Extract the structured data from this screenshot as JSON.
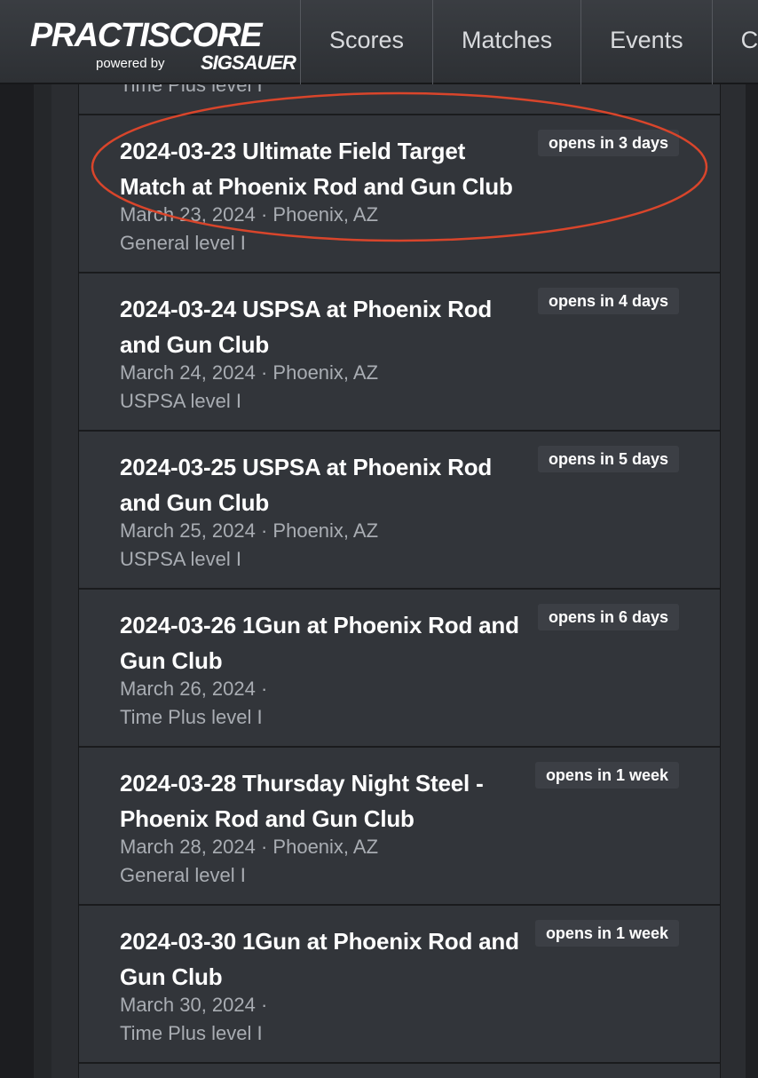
{
  "header": {
    "logo_text": "PRACTISCORE",
    "powered_by": "powered by",
    "brand": "SIGSAUER",
    "nav": [
      "Scores",
      "Matches",
      "Events",
      "C"
    ]
  },
  "partial_item": {
    "meta": "Time Plus level I"
  },
  "matches": [
    {
      "title": "2024-03-23 Ultimate Field Target Match at Phoenix Rod and Gun Club",
      "date_loc": "March 23, 2024 · Phoenix, AZ",
      "level": "General level I",
      "badge": "opens in 3 days"
    },
    {
      "title": "2024-03-24 USPSA at Phoenix Rod and Gun Club",
      "date_loc": "March 24, 2024 · Phoenix, AZ",
      "level": "USPSA level I",
      "badge": "opens in 4 days"
    },
    {
      "title": "2024-03-25 USPSA at Phoenix Rod and Gun Club",
      "date_loc": "March 25, 2024 · Phoenix, AZ",
      "level": "USPSA level I",
      "badge": "opens in 5 days"
    },
    {
      "title": "2024-03-26 1Gun at Phoenix Rod and Gun Club",
      "date_loc": "March 26, 2024 ·",
      "level": "Time Plus level I",
      "badge": "opens in 6 days"
    },
    {
      "title": "2024-03-28 Thursday Night Steel - Phoenix Rod and Gun Club",
      "date_loc": "March 28, 2024 · Phoenix, AZ",
      "level": "General level I",
      "badge": "opens in 1 week"
    },
    {
      "title": "2024-03-30 1Gun at Phoenix Rod and Gun Club",
      "date_loc": "March 30, 2024 ·",
      "level": "Time Plus level I",
      "badge": "opens in 1 week"
    }
  ],
  "colors": {
    "annotation": "#d9452b",
    "badge_bg": "#3c3f45"
  }
}
